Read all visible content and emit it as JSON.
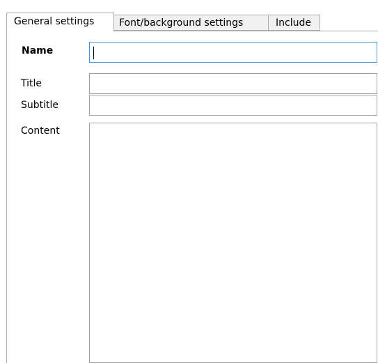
{
  "tabs": [
    {
      "label": "General settings",
      "selected": true
    },
    {
      "label": "Font/background settings",
      "selected": false
    },
    {
      "label": "Include",
      "selected": false
    }
  ],
  "form": {
    "name": {
      "label": "Name",
      "value": "",
      "placeholder": ""
    },
    "title": {
      "label": "Title",
      "value": "",
      "placeholder": ""
    },
    "subtitle": {
      "label": "Subtitle",
      "value": "",
      "placeholder": ""
    },
    "content": {
      "label": "Content",
      "value": "",
      "placeholder": ""
    }
  },
  "colors": {
    "focus_border": "#4a90d9",
    "field_border": "#a0a0a0",
    "tab_inactive_bg": "#f0f0f0"
  }
}
